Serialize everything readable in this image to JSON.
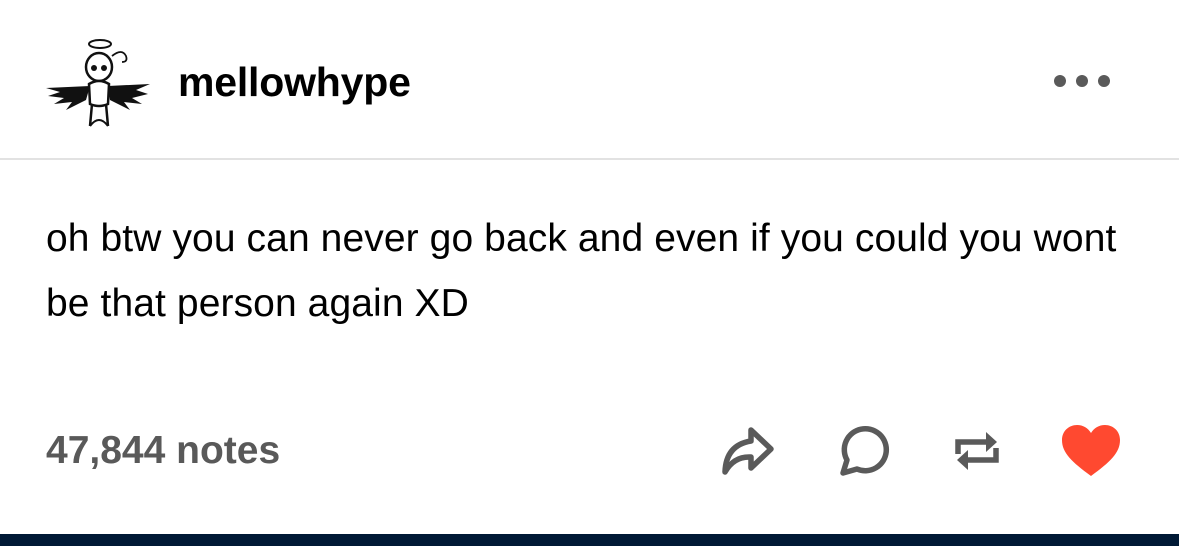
{
  "post": {
    "username": "mellowhype",
    "body_text": "oh btw you can never go back and even if you could you wont be that person again XD",
    "notes_label": "47,844 notes"
  },
  "icons": {
    "avatar": "angel-avatar",
    "more": "ellipsis-icon",
    "share": "share-icon",
    "reply": "reply-icon",
    "reblog": "reblog-icon",
    "like": "heart-icon"
  },
  "colors": {
    "background": "#ffffff",
    "text": "#000000",
    "muted_text": "#595959",
    "icon": "#5a5a5a",
    "divider": "#e2e2e2",
    "like_accent": "#ff4930",
    "bottom_bar": "#001935"
  }
}
